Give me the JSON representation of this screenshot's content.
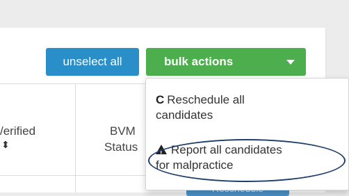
{
  "toolbar": {
    "unselect_label": "unselect all",
    "bulk_label": "bulk actions"
  },
  "table": {
    "headers": [
      {
        "line1": "/erified",
        "sort": "⬍"
      },
      {
        "line1": "BVM",
        "line2": "Status"
      }
    ],
    "row_button": "Reschedule"
  },
  "dropdown": {
    "items": [
      {
        "icon": "refresh-icon",
        "line1": "Reschedule all",
        "line2": "candidates"
      },
      {
        "icon": "warning-icon",
        "line1": "Report all candidates",
        "line2": "for malpractice"
      }
    ]
  },
  "colors": {
    "primary": "#2a8fc9",
    "success": "#4cae4c",
    "annotation": "#1e3d6b"
  }
}
